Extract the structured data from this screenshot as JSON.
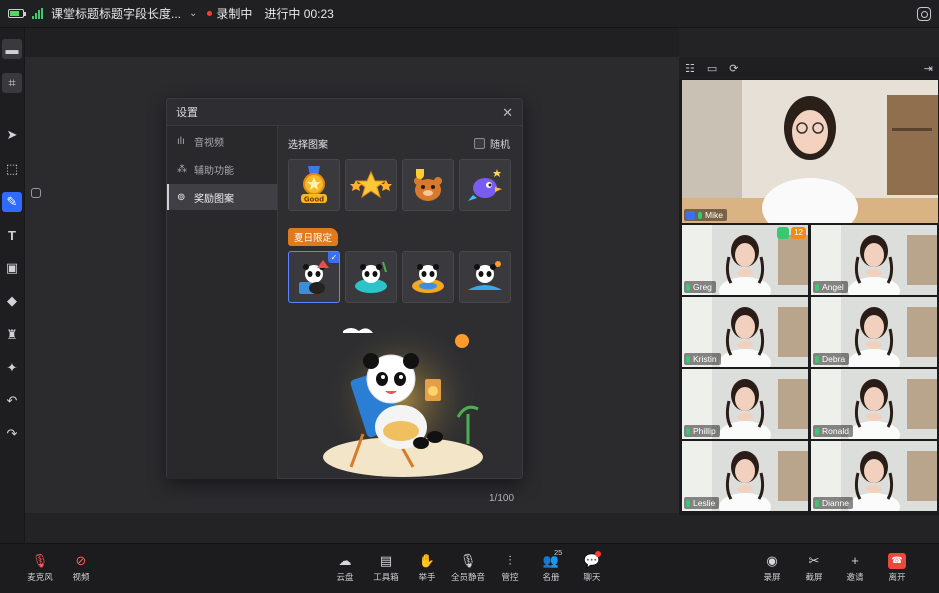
{
  "topbar": {
    "title": "课堂标题标题字段长度...",
    "recording_label": "录制中",
    "progress_label": "进行中",
    "elapsed": "00:23"
  },
  "toolbar_left": {
    "tools": [
      "chat-icon",
      "screenshot-icon",
      "pointer-icon",
      "select-icon",
      "pen-icon",
      "text-icon",
      "image-icon",
      "eraser-icon",
      "clear-icon",
      "magic-icon",
      "undo-icon",
      "redo-icon"
    ]
  },
  "board": {
    "page_indicator": "1/100"
  },
  "dialog": {
    "title": "设置",
    "nav": [
      {
        "label": "音视频",
        "icon": "audio-wave-icon"
      },
      {
        "label": "辅助功能",
        "icon": "accessibility-icon"
      },
      {
        "label": "奖励图案",
        "icon": "reward-icon"
      }
    ],
    "section_title": "选择图案",
    "random_label": "随机",
    "summer_tag": "夏日限定",
    "patterns": [
      "good-medal",
      "three-stars",
      "trophy-bear",
      "rocket-bird"
    ],
    "summer_patterns": [
      "panda-beach",
      "panda-float",
      "panda-swim",
      "panda-surf"
    ],
    "selected_summer_index": 0,
    "preview_alt": "panda-beach"
  },
  "videos": {
    "main": {
      "name": "Mike"
    },
    "badge_count": "12",
    "grid": [
      {
        "name": "Greg"
      },
      {
        "name": "Angel"
      },
      {
        "name": "Kristin"
      },
      {
        "name": "Debra"
      },
      {
        "name": "Phillip"
      },
      {
        "name": "Ronald"
      },
      {
        "name": "Leslie"
      },
      {
        "name": "Dianne"
      }
    ]
  },
  "bottombar": {
    "left": [
      {
        "label": "麦克风"
      },
      {
        "label": "视频"
      }
    ],
    "center": [
      {
        "label": "云盘"
      },
      {
        "label": "工具箱"
      },
      {
        "label": "举手"
      },
      {
        "label": "全员静音"
      },
      {
        "label": "管控"
      },
      {
        "label": "名册",
        "count": "25"
      },
      {
        "label": "聊天"
      }
    ],
    "right": [
      {
        "label": "录屏"
      },
      {
        "label": "截屏"
      },
      {
        "label": "邀请"
      },
      {
        "label": "离开"
      }
    ]
  },
  "colors": {
    "accent": "#2f6bff",
    "summer_tag": "#e07a1f",
    "leave": "#f0473c",
    "mic_on": "#37c871"
  }
}
